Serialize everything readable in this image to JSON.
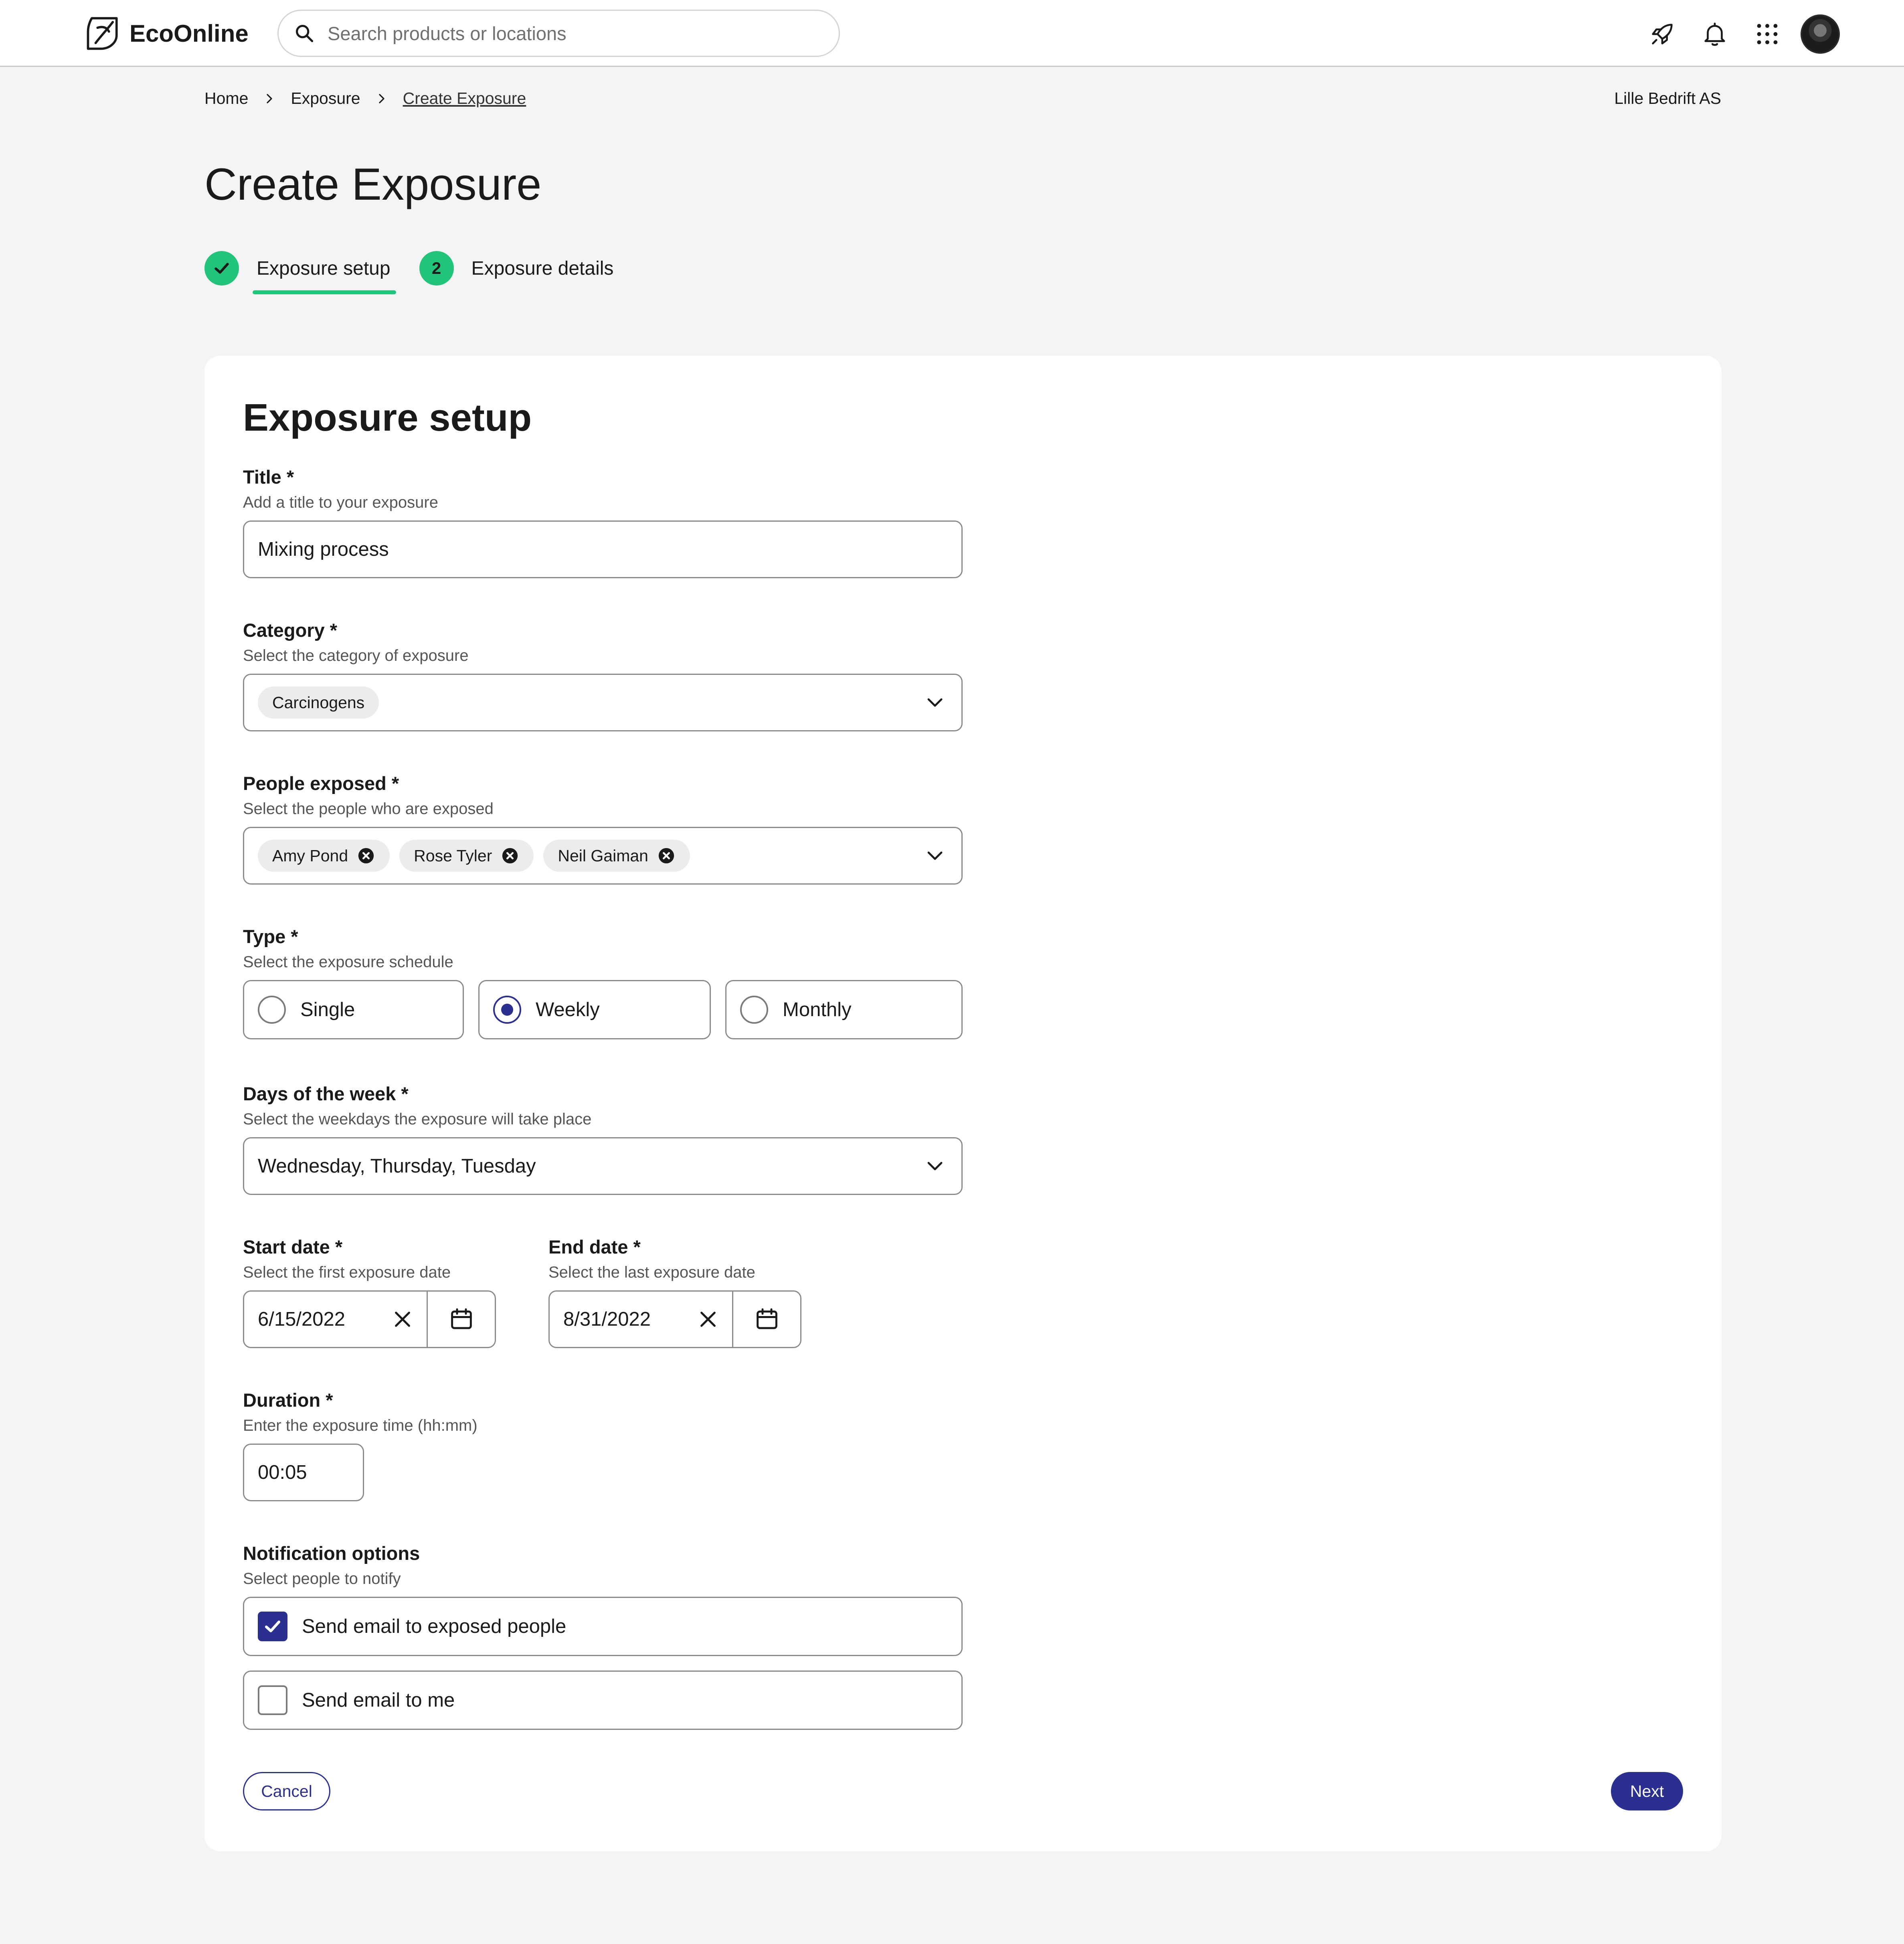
{
  "app": {
    "name": "EcoOnline"
  },
  "search": {
    "placeholder": "Search products or locations"
  },
  "topbar": {
    "icons": [
      "rocket-icon",
      "bell-icon",
      "apps-grid-icon",
      "avatar"
    ]
  },
  "breadcrumb": {
    "items": [
      "Home",
      "Exposure",
      "Create Exposure"
    ]
  },
  "org_name": "Lille Bedrift AS",
  "page_title": "Create Exposure",
  "steps": [
    {
      "number": "1",
      "label": "Exposure setup",
      "status": "complete",
      "active": true
    },
    {
      "number": "2",
      "label": "Exposure details",
      "status": "pending",
      "active": false
    }
  ],
  "form": {
    "title": "Exposure setup",
    "fields": {
      "title": {
        "label": "Title *",
        "hint": "Add a title to your exposure",
        "value": "Mixing process"
      },
      "category": {
        "label": "Category *",
        "hint": "Select the category of exposure",
        "selected": [
          "Carcinogens"
        ]
      },
      "people": {
        "label": "People exposed *",
        "hint": "Select the people who are exposed",
        "selected": [
          "Amy Pond",
          "Rose Tyler",
          "Neil Gaiman"
        ]
      },
      "type": {
        "label": "Type *",
        "hint": "Select the exposure schedule",
        "options": [
          "Single",
          "Weekly",
          "Monthly"
        ],
        "selected": "Weekly"
      },
      "days": {
        "label": "Days of the week *",
        "hint": "Select the weekdays the exposure will take place",
        "value": "Wednesday, Thursday, Tuesday"
      },
      "start_date": {
        "label": "Start date *",
        "hint": "Select the first exposure date",
        "value": "6/15/2022"
      },
      "end_date": {
        "label": "End date *",
        "hint": "Select the last exposure date",
        "value": "8/31/2022"
      },
      "duration": {
        "label": "Duration *",
        "hint": "Enter the exposure time (hh:mm)",
        "value": "00:05"
      },
      "notifications": {
        "label": "Notification options",
        "hint": "Select people to notify",
        "options": [
          {
            "label": "Send email to exposed people",
            "checked": true
          },
          {
            "label": "Send email to me",
            "checked": false
          }
        ]
      }
    },
    "buttons": {
      "cancel": "Cancel",
      "next": "Next"
    }
  },
  "colors": {
    "accent": "#2b2f8f",
    "step_green": "#22c47a",
    "background": "#f4f4f4"
  }
}
